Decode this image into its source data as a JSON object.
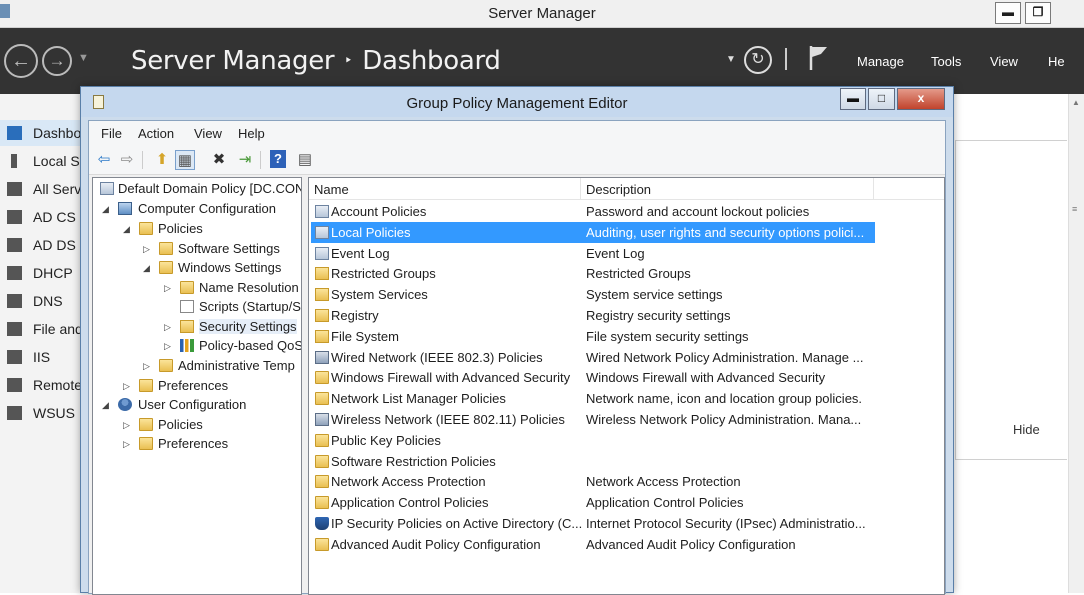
{
  "server_manager": {
    "window_title": "Server Manager",
    "breadcrumb_root": "Server Manager",
    "breadcrumb_sep": "‣",
    "breadcrumb_page": "Dashboard",
    "header_menu": [
      "Manage",
      "Tools",
      "View",
      "He"
    ],
    "sidebar": [
      {
        "label": "Dashbo",
        "icon": "dashboard-icon",
        "active": true
      },
      {
        "label": "Local S",
        "icon": "local-server-icon"
      },
      {
        "label": "All Serv",
        "icon": "all-servers-icon"
      },
      {
        "label": "AD CS",
        "icon": "ad-cs-icon"
      },
      {
        "label": "AD DS",
        "icon": "ad-ds-icon"
      },
      {
        "label": "DHCP",
        "icon": "dhcp-icon"
      },
      {
        "label": "DNS",
        "icon": "dns-icon"
      },
      {
        "label": "File and",
        "icon": "file-services-icon"
      },
      {
        "label": "IIS",
        "icon": "iis-icon"
      },
      {
        "label": "Remote",
        "icon": "remote-access-icon"
      },
      {
        "label": "WSUS",
        "icon": "wsus-icon"
      }
    ],
    "hide_label": "Hide",
    "minimize_glyph": "▬",
    "restore_glyph": "❐"
  },
  "gpme": {
    "window_title": "Group Policy Management Editor",
    "minimize_glyph": "▬",
    "maximize_glyph": "□",
    "close_glyph": "x",
    "menu": [
      "File",
      "Action",
      "View",
      "Help"
    ],
    "toolbar": [
      {
        "icon": "back-arrow-icon",
        "glyph": "⇦"
      },
      {
        "icon": "forward-arrow-icon",
        "glyph": "⇨"
      },
      {
        "icon": "up-folder-icon",
        "glyph": "⬆"
      },
      {
        "icon": "show-hide-tree-icon",
        "glyph": "▦"
      },
      {
        "icon": "delete-icon",
        "glyph": "✖"
      },
      {
        "icon": "export-list-icon",
        "glyph": "⇥"
      },
      {
        "icon": "help-icon",
        "glyph": "?"
      },
      {
        "icon": "properties-icon",
        "glyph": "▤"
      }
    ],
    "tree": [
      {
        "label": "Default Domain Policy [DC.CON",
        "expander": "",
        "icon": "policy"
      },
      {
        "label": "Computer Configuration",
        "expander": "◢",
        "icon": "pc"
      },
      {
        "label": "Policies",
        "expander": "◢",
        "icon": "folder"
      },
      {
        "label": "Software Settings",
        "expander": "▷",
        "icon": "folder"
      },
      {
        "label": "Windows Settings",
        "expander": "◢",
        "icon": "folder"
      },
      {
        "label": "Name Resolution",
        "expander": "▷",
        "icon": "folder"
      },
      {
        "label": "Scripts (Startup/S",
        "expander": "",
        "icon": "script"
      },
      {
        "label": "Security Settings",
        "expander": "▷",
        "icon": "lockfolder",
        "selected": true
      },
      {
        "label": "Policy-based QoS",
        "expander": "▷",
        "icon": "chart"
      },
      {
        "label": "Administrative Temp",
        "expander": "▷",
        "icon": "folder"
      },
      {
        "label": "Preferences",
        "expander": "▷",
        "icon": "folder"
      },
      {
        "label": "User Configuration",
        "expander": "◢",
        "icon": "user"
      },
      {
        "label": "Policies",
        "expander": "▷",
        "icon": "folder"
      },
      {
        "label": "Preferences",
        "expander": "▷",
        "icon": "folder"
      }
    ],
    "columns": {
      "name": "Name",
      "description": "Description"
    },
    "rows": [
      {
        "name": "Account Policies",
        "description": "Password and account lockout policies",
        "icon": "policy"
      },
      {
        "name": "Local Policies",
        "description": "Auditing, user rights and security options polici...",
        "icon": "policy",
        "selected": true
      },
      {
        "name": "Event Log",
        "description": "Event Log",
        "icon": "policy"
      },
      {
        "name": "Restricted Groups",
        "description": "Restricted Groups",
        "icon": "lockfolder"
      },
      {
        "name": "System Services",
        "description": "System service settings",
        "icon": "lockfolder"
      },
      {
        "name": "Registry",
        "description": "Registry security settings",
        "icon": "lockfolder"
      },
      {
        "name": "File System",
        "description": "File system security settings",
        "icon": "lockfolder"
      },
      {
        "name": "Wired Network (IEEE 802.3) Policies",
        "description": "Wired Network Policy Administration. Manage ...",
        "icon": "wifi"
      },
      {
        "name": "Windows Firewall with Advanced Security",
        "description": "Windows Firewall with Advanced Security",
        "icon": "folder"
      },
      {
        "name": "Network List Manager Policies",
        "description": "Network name, icon and location group policies.",
        "icon": "folder"
      },
      {
        "name": "Wireless Network (IEEE 802.11) Policies",
        "description": "Wireless Network Policy Administration. Mana...",
        "icon": "wifi"
      },
      {
        "name": "Public Key Policies",
        "description": "",
        "icon": "folder"
      },
      {
        "name": "Software Restriction Policies",
        "description": "",
        "icon": "folder"
      },
      {
        "name": "Network Access Protection",
        "description": "Network Access Protection",
        "icon": "folder"
      },
      {
        "name": "Application Control Policies",
        "description": "Application Control Policies",
        "icon": "folder"
      },
      {
        "name": "IP Security Policies on Active Directory (C...",
        "description": "Internet Protocol Security (IPsec) Administratio...",
        "icon": "shield"
      },
      {
        "name": "Advanced Audit Policy Configuration",
        "description": "Advanced Audit Policy Configuration",
        "icon": "folder"
      }
    ]
  }
}
